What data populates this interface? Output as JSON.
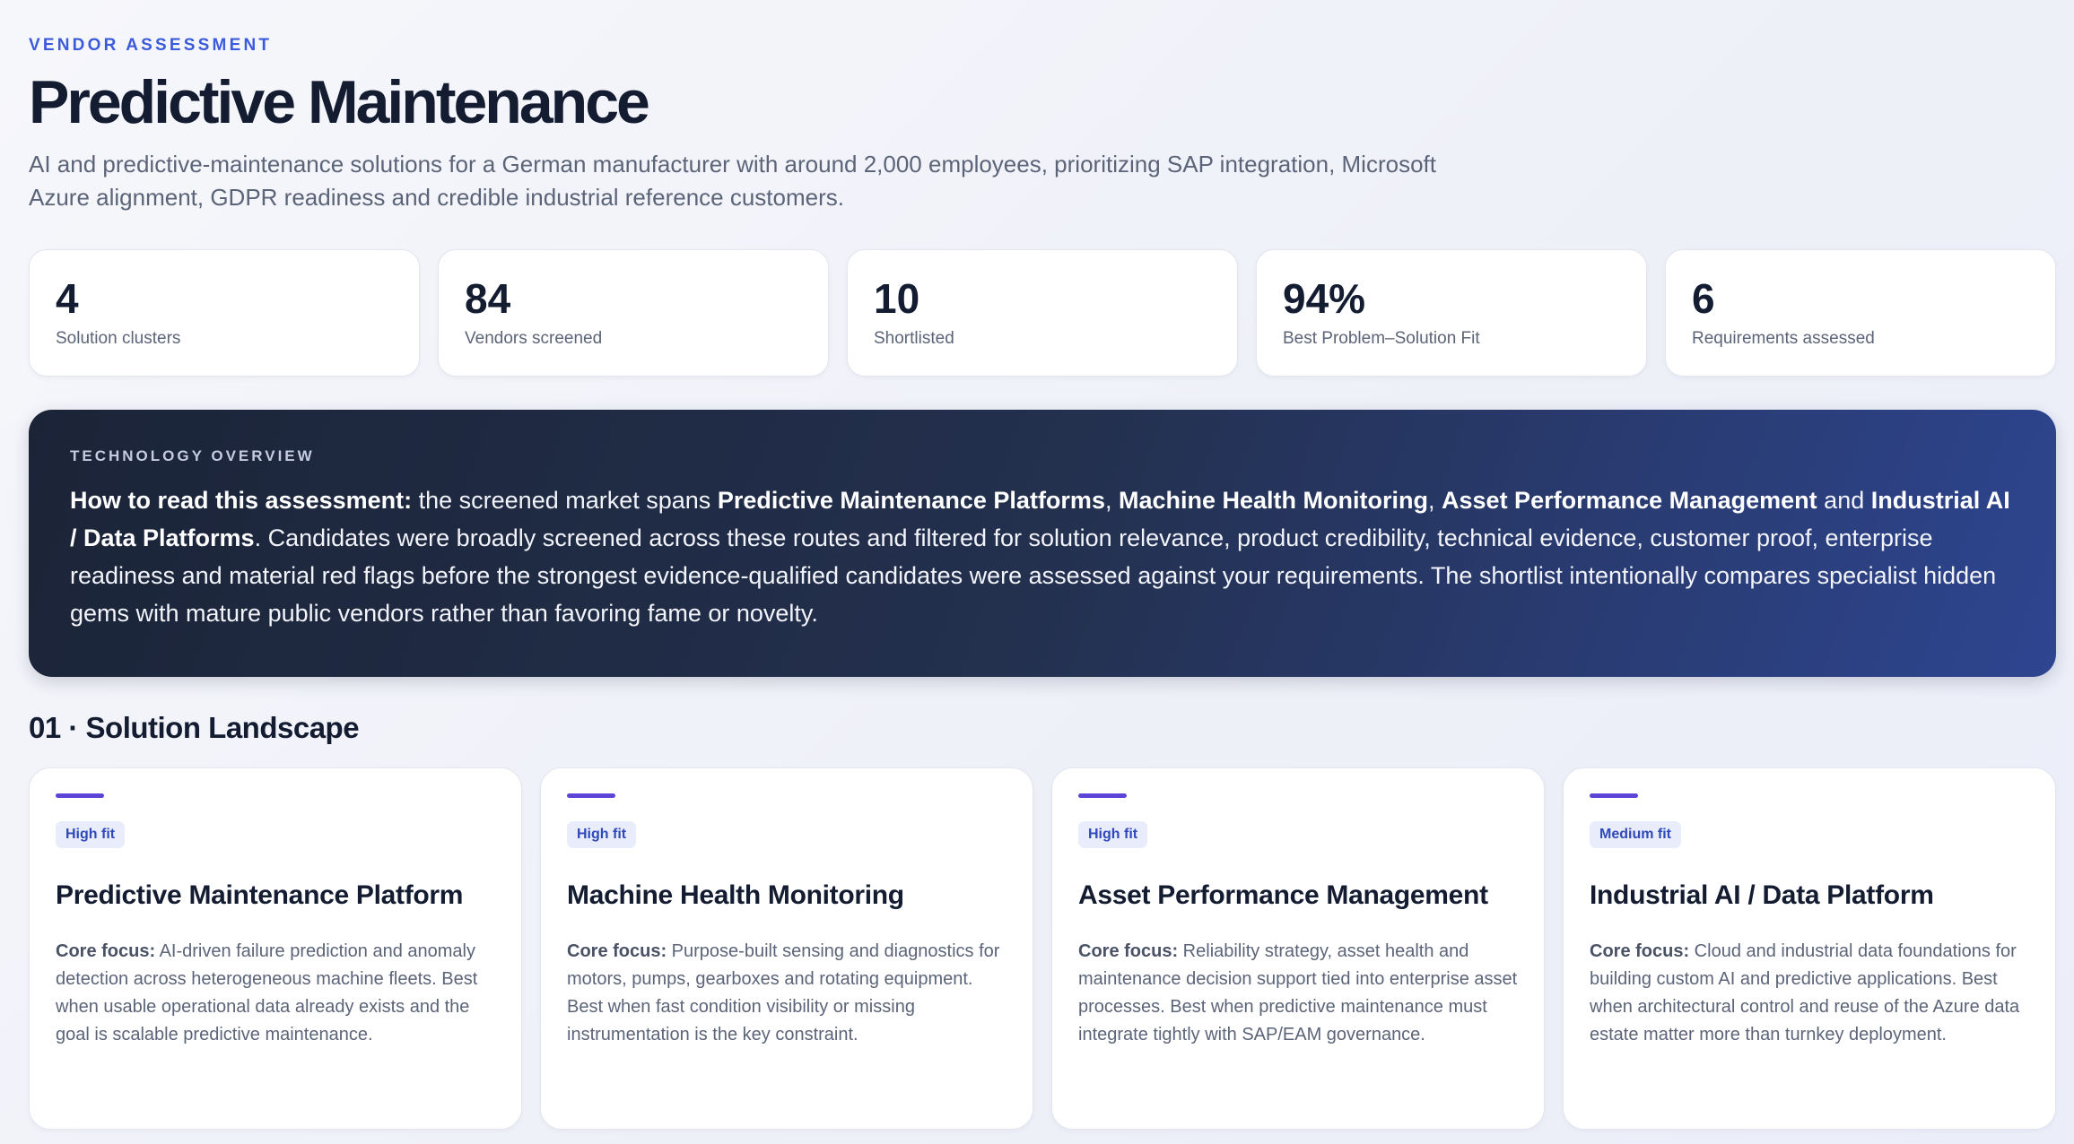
{
  "header": {
    "eyebrow": "VENDOR ASSESSMENT",
    "title": "Predictive Maintenance",
    "subtitle": "AI and predictive-maintenance solutions for a German manufacturer with around 2,000 employees, prioritizing SAP integration, Microsoft Azure alignment, GDPR readiness and credible industrial reference customers."
  },
  "stats": [
    {
      "value": "4",
      "label": "Solution clusters"
    },
    {
      "value": "84",
      "label": "Vendors screened"
    },
    {
      "value": "10",
      "label": "Shortlisted"
    },
    {
      "value": "94%",
      "label": "Best Problem–Solution Fit"
    },
    {
      "value": "6",
      "label": "Requirements assessed"
    }
  ],
  "overview": {
    "eyebrow": "TECHNOLOGY OVERVIEW",
    "lead": "How to read this assessment:",
    "t1": " the screened market spans ",
    "cluster1": "Predictive Maintenance Platforms",
    "sep1": ", ",
    "cluster2": "Machine Health Monitoring",
    "sep2": ", ",
    "cluster3": "Asset Performance Management",
    "sep3": " and ",
    "cluster4": "Industrial AI / Data Platforms",
    "t2": ". Candidates were broadly screened across these routes and filtered for solution relevance, product credibility, technical evidence, customer proof, enterprise readiness and material red flags before the strongest evidence-qualified candidates were assessed against your requirements. The shortlist intentionally compares specialist hidden gems with mature public vendors rather than favoring fame or novelty."
  },
  "section": {
    "title": "01 · Solution Landscape"
  },
  "colors": {
    "accent": "#3b5bdb",
    "accent_bar": "#5b45d6",
    "badge_bg": "#e8ecfb",
    "badge_text": "#2f49b8"
  },
  "cards": [
    {
      "badge": "High fit",
      "title": "Predictive Maintenance Platform",
      "focus_label": "Core focus:",
      "focus_text": " AI-driven failure prediction and anomaly detection across heterogeneous machine fleets. Best when usable operational data already exists and the goal is scalable predictive maintenance."
    },
    {
      "badge": "High fit",
      "title": "Machine Health Monitoring",
      "focus_label": "Core focus:",
      "focus_text": " Purpose-built sensing and diagnostics for motors, pumps, gearboxes and rotating equipment. Best when fast condition visibility or missing instrumentation is the key constraint."
    },
    {
      "badge": "High fit",
      "title": "Asset Performance Management",
      "focus_label": "Core focus:",
      "focus_text": " Reliability strategy, asset health and maintenance decision support tied into enterprise asset processes. Best when predictive maintenance must integrate tightly with SAP/EAM governance."
    },
    {
      "badge": "Medium fit",
      "title": "Industrial AI / Data Platform",
      "focus_label": "Core focus:",
      "focus_text": " Cloud and industrial data foundations for building custom AI and predictive applications. Best when architectural control and reuse of the Azure data estate matter more than turnkey deployment."
    }
  ]
}
